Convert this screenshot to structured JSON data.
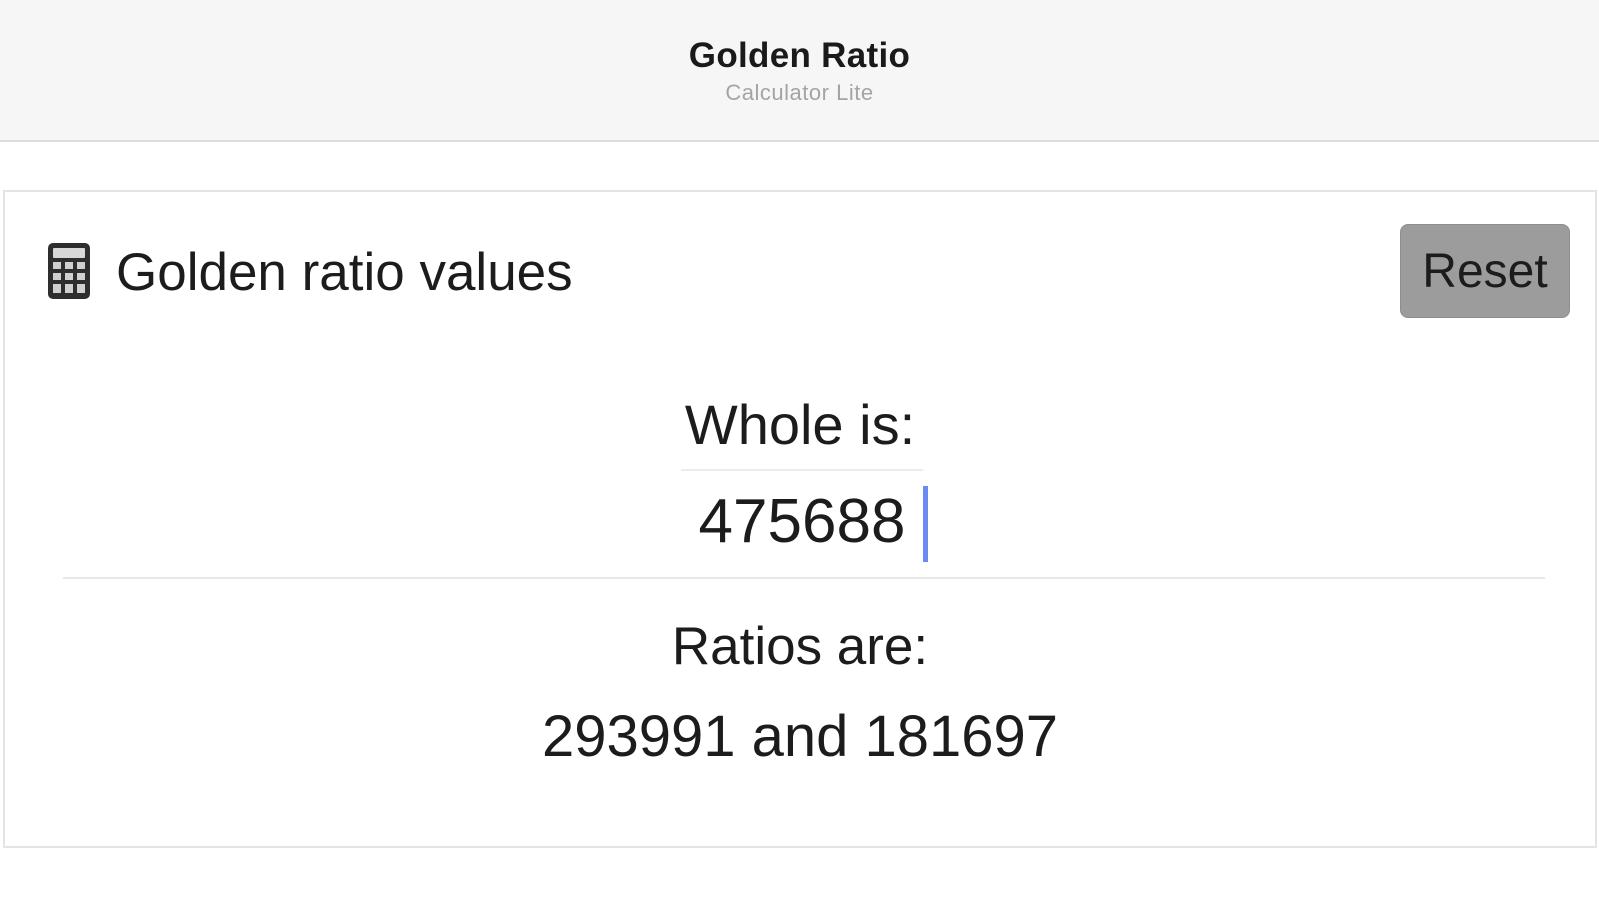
{
  "nav": {
    "title": "Golden Ratio",
    "subtitle": "Calculator Lite"
  },
  "card": {
    "icon": "calculator-icon",
    "title": "Golden ratio values",
    "reset_label": "Reset",
    "whole_label": "Whole is:",
    "whole_value": "475688",
    "ratios_label": "Ratios are:",
    "ratios_value": "293991 and 181697"
  },
  "colors": {
    "nav_background": "#f6f6f6",
    "reset_button": "#9c9c9c",
    "caret": "#6d89f2"
  }
}
